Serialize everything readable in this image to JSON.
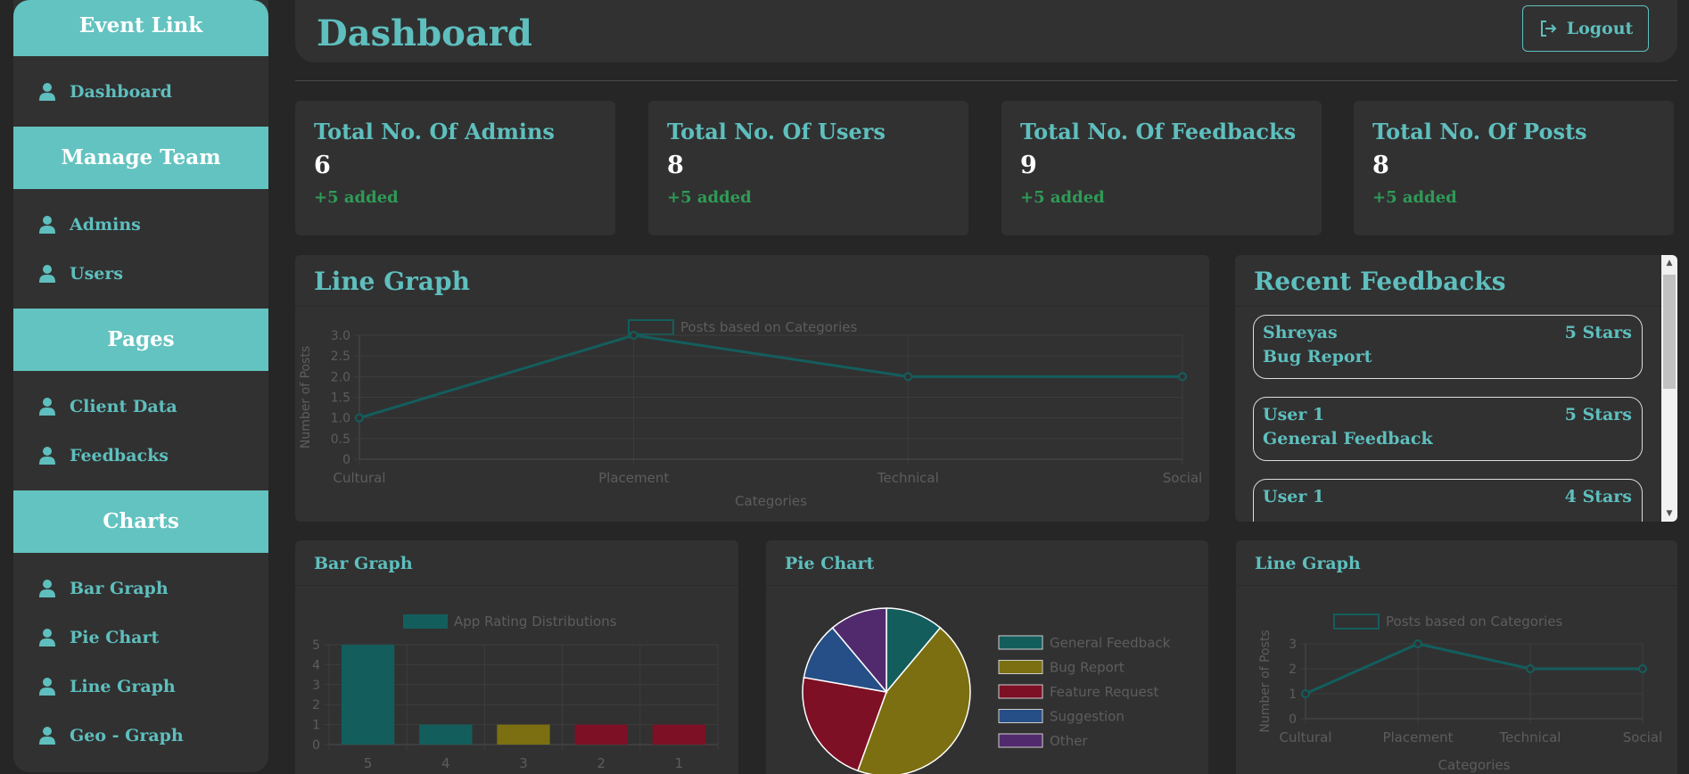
{
  "sidebar": {
    "sections": [
      {
        "title": "Event Link",
        "items": [
          "Dashboard"
        ]
      },
      {
        "title": "Manage Team",
        "items": [
          "Admins",
          "Users"
        ]
      },
      {
        "title": "Pages",
        "items": [
          "Client Data",
          "Feedbacks"
        ]
      },
      {
        "title": "Charts",
        "items": [
          "Bar Graph",
          "Pie Chart",
          "Line Graph",
          "Geo - Graph"
        ]
      }
    ],
    "item_icon": "user-icon"
  },
  "header": {
    "title": "Dashboard",
    "logout_label": "Logout",
    "logout_icon": "logout-icon"
  },
  "stats": [
    {
      "label": "Total No. Of Admins",
      "value": "6",
      "added": "+5 added"
    },
    {
      "label": "Total No. Of Users",
      "value": "8",
      "added": "+5 added"
    },
    {
      "label": "Total No. Of Feedbacks",
      "value": "9",
      "added": "+5 added"
    },
    {
      "label": "Total No. Of Posts",
      "value": "8",
      "added": "+5 added"
    }
  ],
  "line_panel": {
    "title": "Line Graph"
  },
  "feedback_panel": {
    "title": "Recent Feedbacks",
    "items": [
      {
        "name": "Shreyas",
        "stars": "5 Stars",
        "type": "Bug Report"
      },
      {
        "name": "User 1",
        "stars": "5 Stars",
        "type": "General Feedback"
      },
      {
        "name": "User 1",
        "stars": "4 Stars",
        "type": ""
      }
    ]
  },
  "bar_panel": {
    "title": "Bar Graph"
  },
  "pie_panel": {
    "title": "Pie Chart"
  },
  "line_panel_small": {
    "title": "Line Graph"
  },
  "colors": {
    "accent": "#5ebfbe",
    "teal": "#135e5d",
    "olive": "#7b6f11",
    "red": "#7d1025",
    "blue": "#254f86",
    "purple": "#512a6d",
    "added": "#2e9b57"
  },
  "chart_data": [
    {
      "type": "line",
      "categories": [
        "Cultural",
        "Placement",
        "Technical",
        "Social"
      ],
      "series": [
        {
          "name": "Posts based on Categories",
          "values": [
            1,
            3,
            2,
            2
          ]
        }
      ],
      "xlabel": "Categories",
      "ylabel": "Number of Posts",
      "yticks": [
        "3.0",
        "2.5",
        "2.0",
        "1.5",
        "1.0",
        "0.5",
        "0"
      ],
      "ylim": [
        0,
        3
      ],
      "grid": true,
      "legend": "top"
    },
    {
      "type": "bar",
      "categories": [
        "5",
        "4",
        "3",
        "2",
        "1"
      ],
      "series": [
        {
          "name": "App Rating Distributions",
          "values": [
            5,
            1,
            1,
            1,
            1
          ]
        }
      ],
      "yticks": [
        "5",
        "4",
        "3",
        "2",
        "1",
        "0"
      ],
      "ylim": [
        0,
        5
      ],
      "grid": true,
      "legend": "top"
    },
    {
      "type": "pie",
      "labels": [
        "General Feedback",
        "Bug Report",
        "Feature Request",
        "Suggestion",
        "Other"
      ],
      "values": [
        1,
        4,
        2,
        1,
        1
      ],
      "legend": "right"
    },
    {
      "type": "line",
      "categories": [
        "Cultural",
        "Placement",
        "Technical",
        "Social"
      ],
      "series": [
        {
          "name": "Posts based on Categories",
          "values": [
            1,
            3,
            2,
            2
          ]
        }
      ],
      "xlabel": "Categories",
      "ylabel": "Number of Posts",
      "yticks": [
        "3",
        "2",
        "1",
        "0"
      ],
      "ylim": [
        0,
        3
      ],
      "grid": true,
      "legend": "top"
    }
  ]
}
